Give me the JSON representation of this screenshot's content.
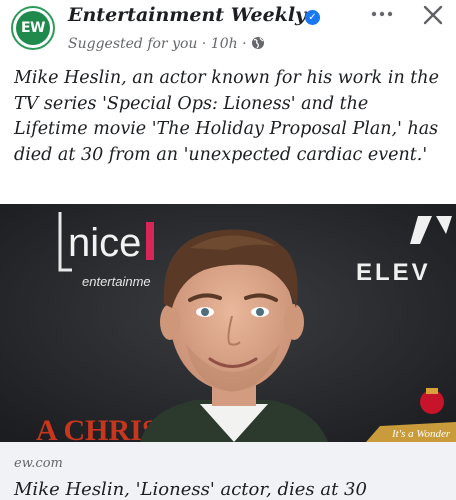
{
  "post": {
    "page_name": "Entertainment Weekly",
    "avatar_text": "EW",
    "meta_text": "Suggested for you · 10h ·",
    "caption": "Mike Heslin, an actor known for his work in the TV series 'Special Ops: Lioness' and the Lifetime movie 'The Holiday Proposal Plan,' has died at 30 from an 'unexpected cardiac event.'"
  },
  "photo": {
    "backdrop_text": {
      "logo_word": "nice",
      "logo_sub": "entertainme",
      "right_word": "ELEV",
      "bottom_word": "A CHRIST",
      "gift_tag": "It's a Wonder"
    }
  },
  "link_preview": {
    "domain": "ew.com",
    "headline": "Mike Heslin, 'Lioness' actor, dies at 30"
  },
  "colors": {
    "brand_green": "#1f8a4c",
    "verified_blue": "#1877f2",
    "preview_bg": "#f0f2f5"
  },
  "icons": {
    "verified": "verified-badge-icon",
    "globe": "globe-icon",
    "more": "more-icon",
    "close": "close-icon"
  }
}
